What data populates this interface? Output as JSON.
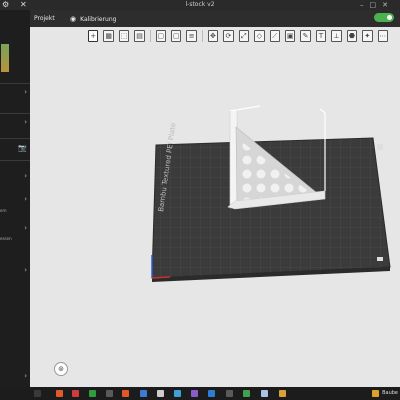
{
  "window": {
    "title": "l-stock v2"
  },
  "menu": {
    "project": "Projekt",
    "calibration": "Kalibrierung"
  },
  "sidebar": {
    "items": [
      {
        "name": "expand"
      },
      {
        "name": "expand"
      },
      {
        "name": "expand"
      },
      {
        "name": "expand"
      },
      {
        "name": "expand"
      },
      {
        "name": "expand"
      }
    ],
    "snippets": [
      "ern",
      "essen"
    ]
  },
  "plate": {
    "brand": "Bambu Textured PEI Plate"
  },
  "taskbar": {
    "label": "Baube"
  },
  "colors": {
    "accent": "#4caf50",
    "plate": "#3b3b3b",
    "titlebar": "#2a2a2a",
    "sidebar": "#1e1e1e"
  }
}
